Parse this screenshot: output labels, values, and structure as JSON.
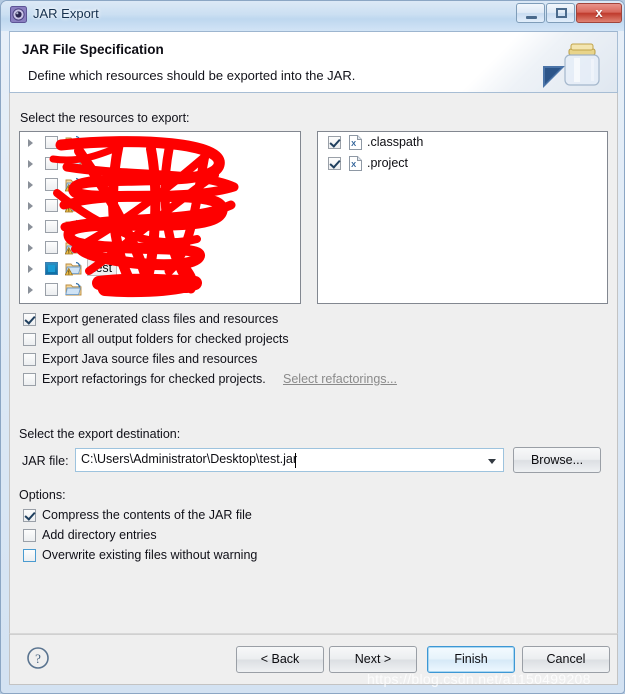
{
  "window": {
    "title": "JAR Export",
    "icon": "jar-export-icon",
    "buttons": {
      "minimize": "minimize-button",
      "maximize": "maximize-button",
      "close_label": "x"
    }
  },
  "header": {
    "title": "JAR File Specification",
    "subtitle": "Define which resources should be exported into the JAR.",
    "image": "jar-illustration"
  },
  "resources": {
    "label": "Select the resources to export:",
    "tree": [
      {
        "label": "",
        "checked": false,
        "obscured": true,
        "warning": true,
        "selected": false
      },
      {
        "label": "",
        "checked": false,
        "obscured": true,
        "warning": true,
        "selected": false
      },
      {
        "label": "",
        "checked": false,
        "obscured": true,
        "warning": true,
        "selected": false
      },
      {
        "label": "",
        "checked": false,
        "obscured": true,
        "warning": true,
        "selected": false
      },
      {
        "label": "",
        "checked": false,
        "obscured": true,
        "warning": true,
        "selected": false
      },
      {
        "label": "",
        "checked": false,
        "obscured": true,
        "warning": true,
        "selected": false
      },
      {
        "label": "test",
        "checked": true,
        "obscured": false,
        "warning": true,
        "selected": true
      },
      {
        "label": "",
        "checked": false,
        "obscured": true,
        "warning": false,
        "selected": false
      }
    ],
    "files": [
      {
        "label": ".classpath",
        "checked": true,
        "icon": "xml-file-icon"
      },
      {
        "label": ".project",
        "checked": true,
        "icon": "xml-file-icon"
      }
    ]
  },
  "export_options": [
    {
      "label": "Export generated class files and resources",
      "checked": true
    },
    {
      "label": "Export all output folders for checked projects",
      "checked": false
    },
    {
      "label": "Export Java source files and resources",
      "checked": false
    },
    {
      "label": "Export refactorings for checked projects.",
      "checked": false
    }
  ],
  "refactorings_link": "Select refactorings...",
  "destination": {
    "label": "Select the export destination:",
    "jar_file_label": "JAR file:",
    "jar_file_value": "C:\\Users\\Administrator\\Desktop\\test.jar",
    "browse_label": "Browse..."
  },
  "options": {
    "label": "Options:",
    "items": [
      {
        "label": "Compress the contents of the JAR file",
        "checked": true,
        "focused": false
      },
      {
        "label": "Add directory entries",
        "checked": false,
        "focused": false
      },
      {
        "label": "Overwrite existing files without warning",
        "checked": false,
        "focused": true
      }
    ]
  },
  "footer": {
    "help": "help-button",
    "back_label": "< Back",
    "next_label": "Next >",
    "finish_label": "Finish",
    "cancel_label": "Cancel"
  },
  "watermark": "https://blog.csdn.net/a1150499208",
  "colors": {
    "accent": "#3d97d4",
    "close_button": "#bf3b2d",
    "checkbox_fill": "#0b6ea4",
    "scribble": "#fe0000"
  }
}
